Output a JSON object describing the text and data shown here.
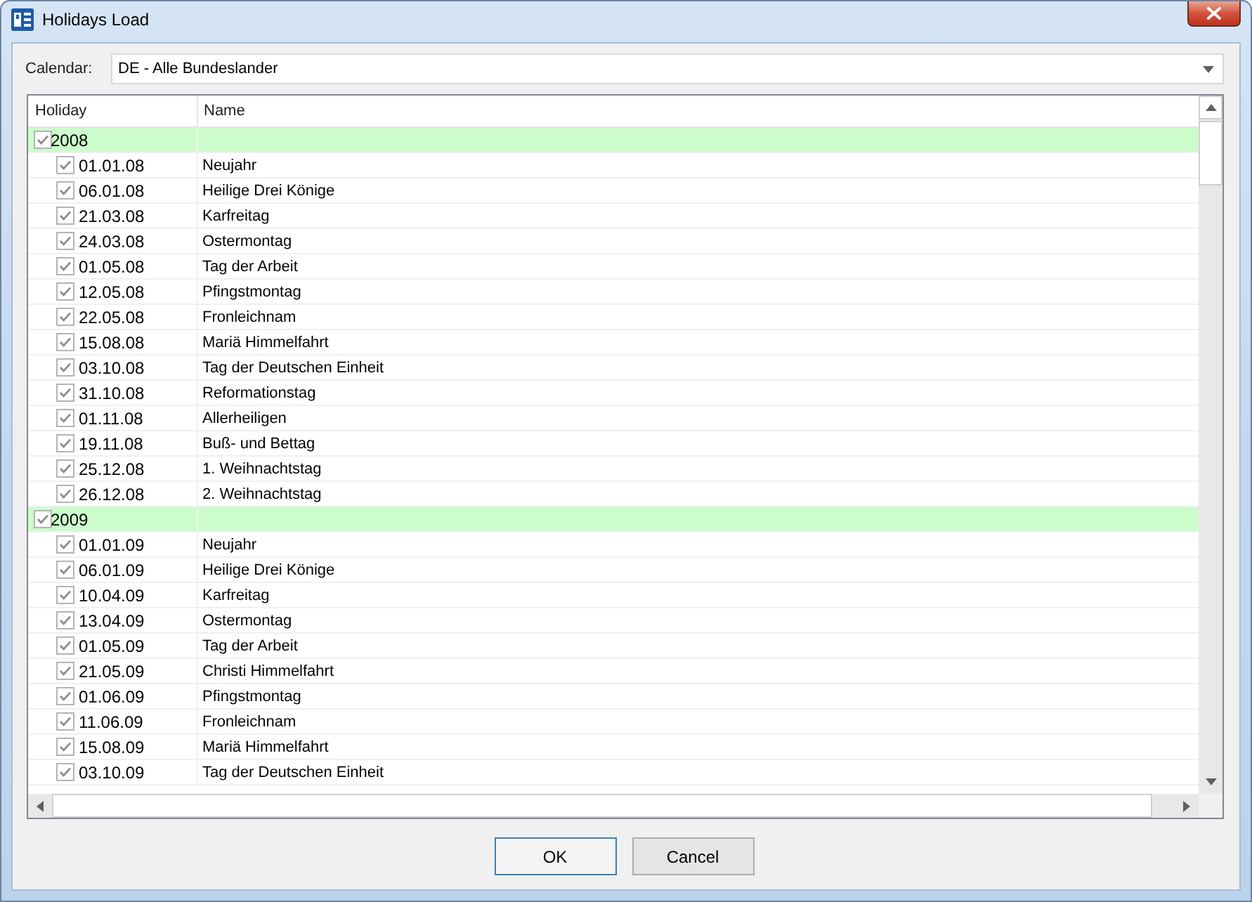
{
  "window": {
    "title": "Holidays Load"
  },
  "calendar": {
    "label": "Calendar:",
    "value": "DE - Alle Bundeslander"
  },
  "grid": {
    "columns": [
      "Holiday",
      "Name"
    ],
    "groups": [
      {
        "year": "2008",
        "checked": true,
        "children": [
          {
            "date": "01.01.08",
            "name": "Neujahr",
            "checked": true
          },
          {
            "date": "06.01.08",
            "name": "Heilige Drei Könige",
            "checked": true
          },
          {
            "date": "21.03.08",
            "name": "Karfreitag",
            "checked": true
          },
          {
            "date": "24.03.08",
            "name": "Ostermontag",
            "checked": true
          },
          {
            "date": "01.05.08",
            "name": "Tag der Arbeit",
            "checked": true
          },
          {
            "date": "12.05.08",
            "name": "Pfingstmontag",
            "checked": true
          },
          {
            "date": "22.05.08",
            "name": "Fronleichnam",
            "checked": true
          },
          {
            "date": "15.08.08",
            "name": "Mariä Himmelfahrt",
            "checked": true
          },
          {
            "date": "03.10.08",
            "name": "Tag der Deutschen Einheit",
            "checked": true
          },
          {
            "date": "31.10.08",
            "name": "Reformationstag",
            "checked": true
          },
          {
            "date": "01.11.08",
            "name": "Allerheiligen",
            "checked": true
          },
          {
            "date": "19.11.08",
            "name": "Buß- und Bettag",
            "checked": true
          },
          {
            "date": "25.12.08",
            "name": "1. Weihnachtstag",
            "checked": true
          },
          {
            "date": "26.12.08",
            "name": "2. Weihnachtstag",
            "checked": true
          }
        ]
      },
      {
        "year": "2009",
        "checked": true,
        "children": [
          {
            "date": "01.01.09",
            "name": "Neujahr",
            "checked": true
          },
          {
            "date": "06.01.09",
            "name": "Heilige Drei Könige",
            "checked": true
          },
          {
            "date": "10.04.09",
            "name": "Karfreitag",
            "checked": true
          },
          {
            "date": "13.04.09",
            "name": "Ostermontag",
            "checked": true
          },
          {
            "date": "01.05.09",
            "name": "Tag der Arbeit",
            "checked": true
          },
          {
            "date": "21.05.09",
            "name": "Christi Himmelfahrt",
            "checked": true
          },
          {
            "date": "01.06.09",
            "name": "Pfingstmontag",
            "checked": true
          },
          {
            "date": "11.06.09",
            "name": "Fronleichnam",
            "checked": true
          },
          {
            "date": "15.08.09",
            "name": "Mariä Himmelfahrt",
            "checked": true
          },
          {
            "date": "03.10.09",
            "name": "Tag der Deutschen Einheit",
            "checked": true
          }
        ]
      }
    ]
  },
  "buttons": [
    {
      "label": "OK",
      "default": true
    },
    {
      "label": "Cancel",
      "default": false
    }
  ]
}
